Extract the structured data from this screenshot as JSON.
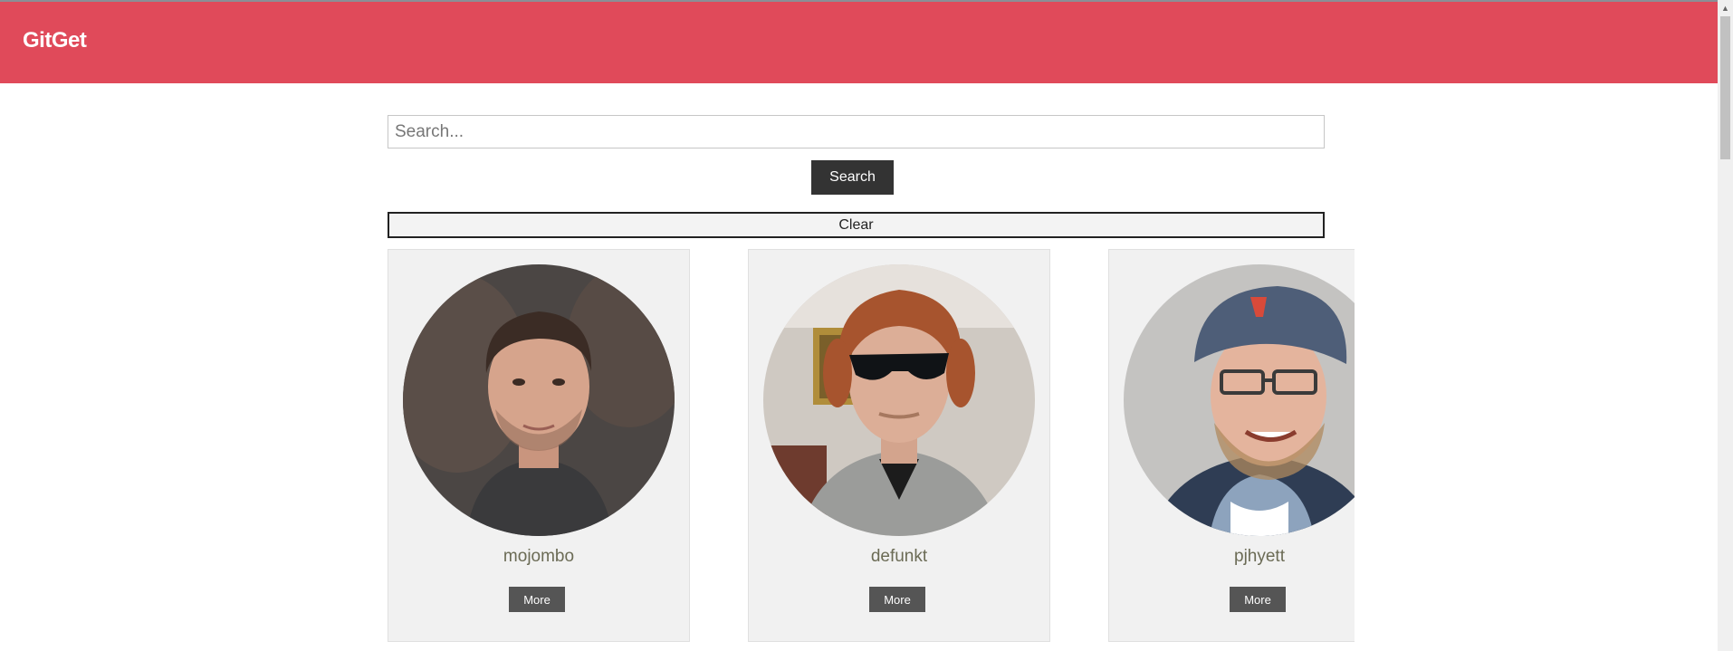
{
  "app": {
    "brand": "GitGet"
  },
  "search": {
    "placeholder": "Search...",
    "value": "",
    "button_label": "Search"
  },
  "clear": {
    "label": "Clear"
  },
  "users": [
    {
      "login": "mojombo",
      "more_label": "More"
    },
    {
      "login": "defunkt",
      "more_label": "More"
    },
    {
      "login": "pjhyett",
      "more_label": "More"
    }
  ],
  "icons": {
    "scroll_up": "scroll-up-arrow-icon"
  },
  "colors": {
    "navbar": "#e04a5a",
    "primary_button": "#333333",
    "more_button": "#555555",
    "card_background": "#f1f1f1",
    "username": "#6b6b55"
  }
}
